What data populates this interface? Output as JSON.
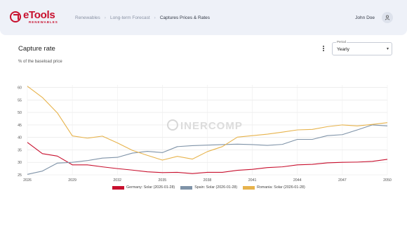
{
  "header": {
    "logo_name": "eTools",
    "logo_sub": "RENEWABLES",
    "breadcrumb": [
      "Renewables",
      "Long-term Forecast",
      "Captures Prices & Rates"
    ],
    "user_name": "John Doe"
  },
  "card": {
    "title": "Capture rate",
    "subtitle": "% of the baseload price",
    "period_label": "Period",
    "period_value": "Yearly"
  },
  "watermark": "INERCOMP",
  "chart_data": {
    "type": "line",
    "x": [
      2026,
      2027,
      2028,
      2029,
      2030,
      2031,
      2032,
      2033,
      2034,
      2035,
      2036,
      2037,
      2038,
      2039,
      2040,
      2041,
      2042,
      2043,
      2044,
      2045,
      2046,
      2047,
      2048,
      2049,
      2050
    ],
    "x_ticks": [
      "2026",
      "2029",
      "2032",
      "2035",
      "2038",
      "2041",
      "2044",
      "2047",
      "2050"
    ],
    "y_ticks": [
      "25",
      "30",
      "35",
      "40",
      "45",
      "50",
      "55",
      "60"
    ],
    "ylim": [
      25,
      61
    ],
    "grid": true,
    "legend_position": "bottom",
    "series": [
      {
        "name": "Germany: Solar (2026-01-28)",
        "color": "#c8102e",
        "values": [
          38,
          33.5,
          32.5,
          29,
          29,
          28.2,
          27.5,
          26.9,
          26.2,
          25.9,
          26,
          25.5,
          26,
          26,
          26.8,
          27.2,
          27.9,
          28.2,
          29,
          29.2,
          29.8,
          30,
          30.1,
          30.4,
          31.2
        ]
      },
      {
        "name": "Spain: Solar (2026-01-28)",
        "color": "#7f93a8",
        "values": [
          25.2,
          26.5,
          29.7,
          30,
          30.7,
          31.7,
          32,
          33.7,
          34.4,
          33.9,
          36.3,
          36.7,
          36.9,
          37.1,
          37.3,
          37.1,
          36.8,
          37.2,
          39.2,
          39.2,
          40.7,
          41.1,
          43,
          45,
          44.6
        ]
      },
      {
        "name": "Romania: Solar (2026-01-28)",
        "color": "#e7b34c",
        "values": [
          60.5,
          56,
          49.8,
          40.6,
          39.7,
          40.5,
          37.8,
          34.8,
          32.8,
          30.9,
          32.4,
          31.3,
          34.3,
          36.3,
          40.1,
          40.7,
          41.3,
          42.1,
          43,
          43.2,
          44.3,
          45,
          44.6,
          45.2,
          45.9
        ]
      }
    ]
  }
}
